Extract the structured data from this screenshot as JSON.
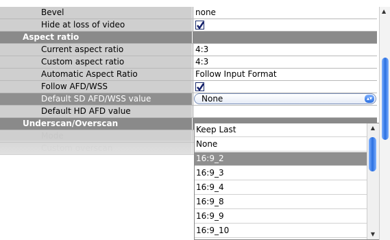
{
  "properties": {
    "bevel": {
      "label": "Bevel",
      "value": "none"
    },
    "hide_loss": {
      "label": "Hide at loss of video"
    },
    "aspect_section": {
      "label": "Aspect ratio"
    },
    "current_ar": {
      "label": "Current aspect ratio",
      "value": "4:3"
    },
    "custom_ar": {
      "label": "Custom aspect ratio",
      "value": "4:3"
    },
    "auto_ar": {
      "label": "Automatic Aspect Ratio",
      "value": "Follow Input Format"
    },
    "follow_afd": {
      "label": "Follow AFD/WSS"
    },
    "default_sd": {
      "label": "Default SD AFD/WSS value",
      "value": "None"
    },
    "default_hd": {
      "label": "Default HD AFD value"
    },
    "underscan_section": {
      "label": "Underscan/Overscan"
    },
    "mode": {
      "label": "Mode"
    },
    "custom_overscan": {
      "label": "Custom overscan"
    }
  },
  "dropdown": {
    "options": [
      "Keep Last",
      "None",
      "16:9_2",
      "16:9_3",
      "16:9_4",
      "16:9_8",
      "16:9_9",
      "16:9_10"
    ],
    "selected_index": 2
  },
  "icons": {
    "collapse": "collapse-toggle-icon",
    "checkbox": "checkbox-checked-icon",
    "combo_arrow": "dropdown-arrow-icon"
  }
}
